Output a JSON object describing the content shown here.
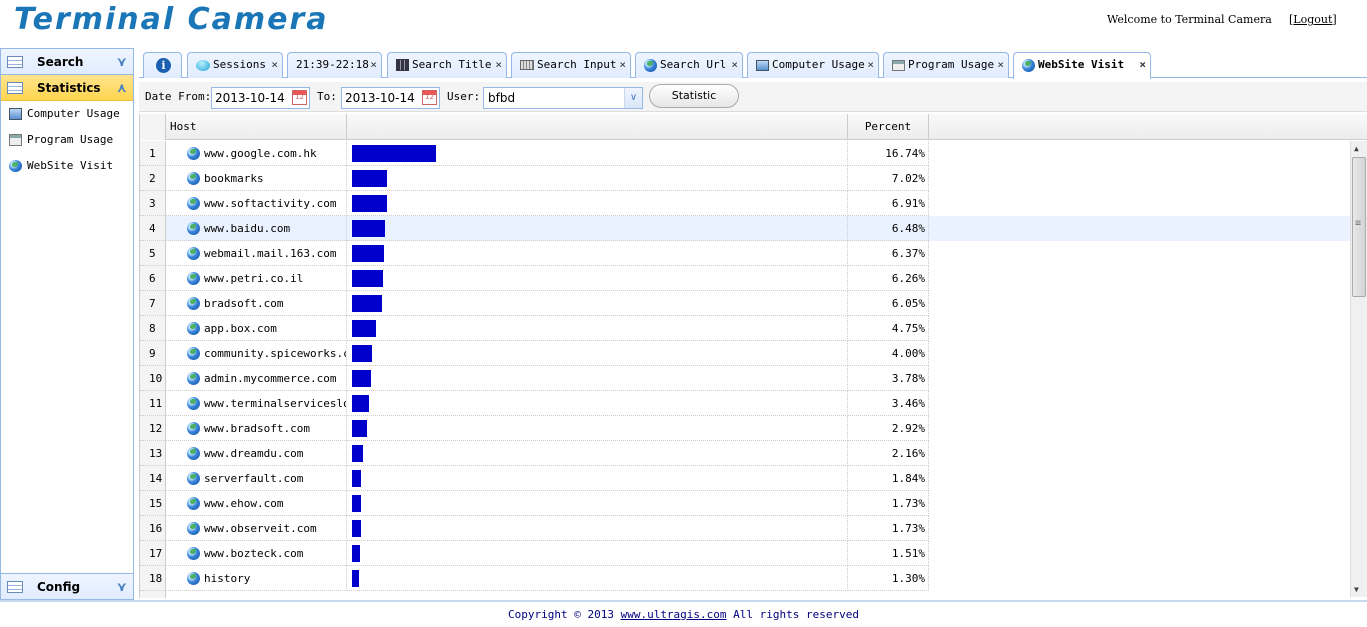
{
  "header": {
    "logo": "Terminal Camera",
    "welcome": "Welcome to Terminal Camera",
    "logout_open": "[",
    "logout_label": "Logout",
    "logout_close": "]"
  },
  "sidebar": {
    "search_label": "Search",
    "statistics_label": "Statistics",
    "config_label": "Config",
    "items": [
      {
        "label": "Computer Usage",
        "icon": "monitor-icon"
      },
      {
        "label": "Program Usage",
        "icon": "window-icon"
      },
      {
        "label": "WebSite Visit",
        "icon": "globe-icon"
      }
    ]
  },
  "tabs": [
    {
      "label": "",
      "icon": "info-icon"
    },
    {
      "label": "Sessions",
      "icon": "chat-icon"
    },
    {
      "label": "21:39-22:18",
      "icon": ""
    },
    {
      "label": "Search Title",
      "icon": "grid-icon"
    },
    {
      "label": "Search Input",
      "icon": "keyboard-icon"
    },
    {
      "label": "Search Url",
      "icon": "globe-icon"
    },
    {
      "label": "Computer Usage",
      "icon": "monitor-icon"
    },
    {
      "label": "Program Usage",
      "icon": "window-icon"
    },
    {
      "label": "WebSite Visit",
      "icon": "globe-icon",
      "active": true
    }
  ],
  "tab_close": "×",
  "toolbar": {
    "date_from_label": "Date From:",
    "date_from": "2013-10-14",
    "to_label": "To:",
    "date_to": "2013-10-14",
    "user_label": "User:",
    "user": "bfbd",
    "statistic_button": "Statistic"
  },
  "grid": {
    "col_host": "Host",
    "col_percent": "Percent",
    "rows": [
      {
        "n": "1",
        "host": "www.google.com.hk",
        "pct": "16.74%",
        "v": 16.74
      },
      {
        "n": "2",
        "host": "bookmarks",
        "pct": "7.02%",
        "v": 7.02
      },
      {
        "n": "3",
        "host": "www.softactivity.com",
        "pct": "6.91%",
        "v": 6.91
      },
      {
        "n": "4",
        "host": "www.baidu.com",
        "pct": "6.48%",
        "v": 6.48
      },
      {
        "n": "5",
        "host": "webmail.mail.163.com",
        "pct": "6.37%",
        "v": 6.37
      },
      {
        "n": "6",
        "host": "www.petri.co.il",
        "pct": "6.26%",
        "v": 6.26
      },
      {
        "n": "7",
        "host": "bradsoft.com",
        "pct": "6.05%",
        "v": 6.05
      },
      {
        "n": "8",
        "host": "app.box.com",
        "pct": "4.75%",
        "v": 4.75
      },
      {
        "n": "9",
        "host": "community.spiceworks.com",
        "pct": "4.00%",
        "v": 4.0
      },
      {
        "n": "10",
        "host": "admin.mycommerce.com",
        "pct": "3.78%",
        "v": 3.78
      },
      {
        "n": "11",
        "host": "www.terminalserviceslog.",
        "pct": "3.46%",
        "v": 3.46
      },
      {
        "n": "12",
        "host": "www.bradsoft.com",
        "pct": "2.92%",
        "v": 2.92
      },
      {
        "n": "13",
        "host": "www.dreamdu.com",
        "pct": "2.16%",
        "v": 2.16
      },
      {
        "n": "14",
        "host": "serverfault.com",
        "pct": "1.84%",
        "v": 1.84
      },
      {
        "n": "15",
        "host": "www.ehow.com",
        "pct": "1.73%",
        "v": 1.73
      },
      {
        "n": "16",
        "host": "www.observeit.com",
        "pct": "1.73%",
        "v": 1.73
      },
      {
        "n": "17",
        "host": "www.bozteck.com",
        "pct": "1.51%",
        "v": 1.51
      },
      {
        "n": "18",
        "host": "history",
        "pct": "1.30%",
        "v": 1.3
      }
    ],
    "highlighted_row": 3,
    "bar_color": "#0000cc"
  },
  "footer": {
    "copyright": "Copyright © 2013",
    "link": "www.ultragis.com",
    "rights": "All rights reserved"
  }
}
